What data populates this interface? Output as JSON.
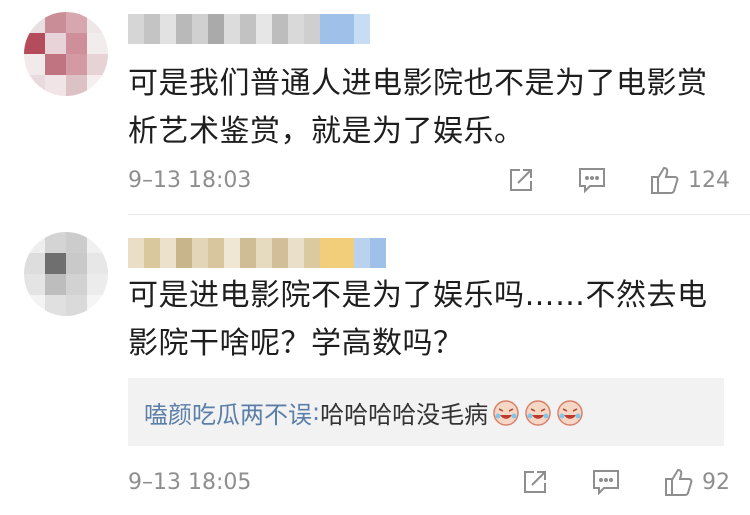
{
  "comments": [
    {
      "text_lines": [
        "可是我们普通人进电影院也不是为了电影赏",
        "析艺术鉴赏，就是为了娱乐。"
      ],
      "time": "9–13 18:03",
      "likes": "124"
    },
    {
      "text_lines": [
        "可是进电影院不是为了娱乐吗……不然去电",
        "影院干啥呢？学高数吗？"
      ],
      "time": "9–13 18:05",
      "likes": "92",
      "subreply": {
        "user": "嗑颜吃瓜两不误",
        "separator": ": ",
        "text": "哈哈哈哈没毛病",
        "emoji": [
          "laughing-emoji",
          "laughing-emoji",
          "laughing-emoji"
        ]
      }
    }
  ],
  "icons": {
    "share": "share-icon",
    "reply": "comment-icon",
    "like": "thumbs-up-icon"
  },
  "colors": {
    "sub_user": "#5b7fa8",
    "meta": "#8e8e8e",
    "subreply_bg": "#f2f2f2"
  }
}
